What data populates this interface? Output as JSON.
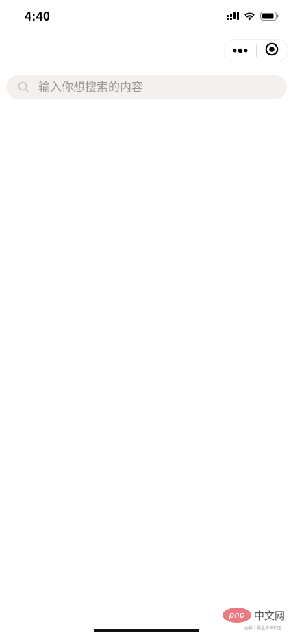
{
  "status_bar": {
    "time": "4:40",
    "icons": [
      "signal-icon",
      "wifi-icon",
      "battery-icon"
    ]
  },
  "capsule": {
    "icons": [
      "more-dots-icon",
      "close-target-icon"
    ]
  },
  "search": {
    "placeholder": "输入你想搜索的内容",
    "value": "",
    "icon": "search-icon"
  },
  "watermark": {
    "badge_text": "php",
    "label": "中文网",
    "subtext": "@稀土掘金技术社区"
  },
  "colors": {
    "background": "#ffffff",
    "search_background": "#f3f0ee",
    "placeholder": "#9a9696",
    "watermark_badge": "#e8626c"
  }
}
